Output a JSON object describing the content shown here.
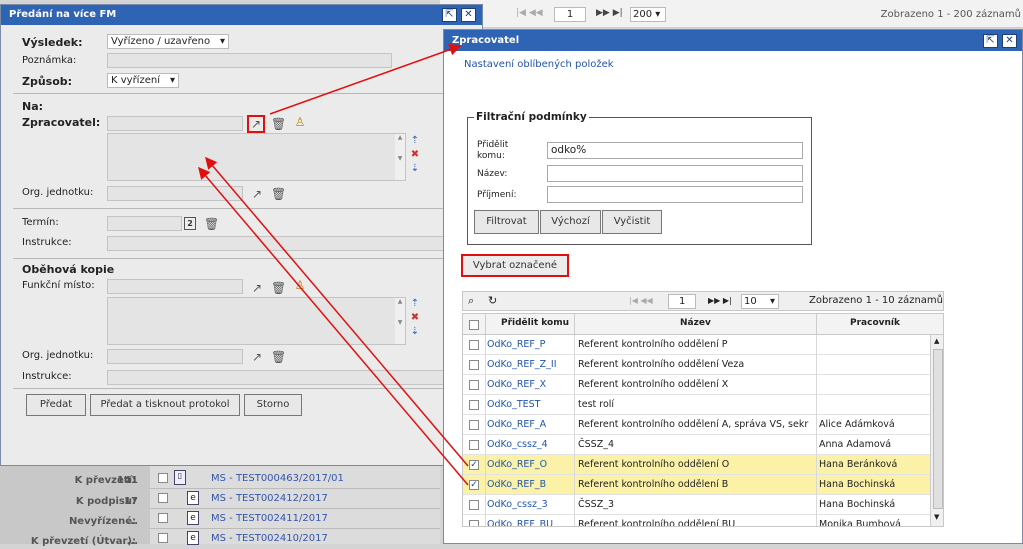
{
  "bg": {
    "pager_page": "1",
    "pager_size": "200",
    "status": "Zobrazeno 1 - 200 záznamů",
    "counters": [
      {
        "label": "K převzetí:",
        "value": "141"
      },
      {
        "label": "K podpisu:",
        "value": "17"
      },
      {
        "label": "Nevyřízené:",
        "value": "..."
      },
      {
        "label": "K převzetí (Útvar):",
        "value": "..."
      }
    ],
    "rows": [
      "MS - TEST000463/2017/01",
      "MS - TEST002412/2017",
      "MS - TEST002411/2017",
      "MS - TEST002410/2017"
    ]
  },
  "left": {
    "title": "Předání na více FM",
    "vysledek_label": "Výsledek:",
    "vysledek_value": "Vyřízeno / uzavřeno",
    "poznamka_label": "Poznámka:",
    "zpusob_label": "Způsob:",
    "zpusob_value": "K vyřízení",
    "na_label": "Na:",
    "zpracovatel_label": "Zpracovatel:",
    "org_label": "Org. jednotku:",
    "termin_label": "Termín:",
    "instrukce_label": "Instrukce:",
    "obehova_label": "Oběhová kopie",
    "funkcni_label": "Funkční místo:",
    "org2_label": "Org. jednotku:",
    "instrukce2_label": "Instrukce:",
    "btn_predat": "Předat",
    "btn_predat_tisk": "Předat a tisknout protokol",
    "btn_storno": "Storno"
  },
  "right": {
    "title": "Zpracovatel",
    "fav_link": "Nastavení oblíbených položek",
    "filter_legend": "Filtrační podmínky",
    "f_pridelit_label": "Přidělit komu:",
    "f_pridelit_value": "odko%",
    "f_nazev_label": "Název:",
    "f_prijmeni_label": "Příjmení:",
    "btn_filtrovat": "Filtrovat",
    "btn_vychozi": "Výchozí",
    "btn_vycistit": "Vyčistit",
    "btn_vybrat": "Vybrat označené",
    "pager_page": "1",
    "pager_size": "10",
    "status": "Zobrazeno 1 - 10 záznamů",
    "col_pridelit": "Přidělit komu",
    "col_nazev": "Název",
    "col_pracovnik": "Pracovník",
    "rows": [
      {
        "komu": "OdKo_REF_P",
        "nazev": "Referent kontrolního oddělení P",
        "pracovnik": "",
        "checked": false
      },
      {
        "komu": "OdKo_REF_Z_II",
        "nazev": "Referent kontrolního oddělení Veza",
        "pracovnik": "",
        "checked": false
      },
      {
        "komu": "OdKo_REF_X",
        "nazev": "Referent kontrolního oddělení X",
        "pracovnik": "",
        "checked": false
      },
      {
        "komu": "OdKo_TEST",
        "nazev": "test rolí",
        "pracovnik": "",
        "checked": false
      },
      {
        "komu": "OdKo_REF_A",
        "nazev": "Referent kontrolního oddělení A, správa VS, sekr",
        "pracovnik": "Alice Adámková",
        "checked": false
      },
      {
        "komu": "OdKo_cssz_4",
        "nazev": "ČSSZ_4",
        "pracovnik": "Anna Adamová",
        "checked": false
      },
      {
        "komu": "OdKo_REF_O",
        "nazev": "Referent kontrolního oddělení O",
        "pracovnik": "Hana Beránková",
        "checked": true
      },
      {
        "komu": "OdKo_REF_B",
        "nazev": "Referent kontrolního oddělení B",
        "pracovnik": "Hana Bochinská",
        "checked": true
      },
      {
        "komu": "OdKo_cssz_3",
        "nazev": "ČSSZ_3",
        "pracovnik": "Hana Bochinská",
        "checked": false
      },
      {
        "komu": "OdKo_REF_BU",
        "nazev": "Referent kontrolního oddělení BU",
        "pracovnik": "Monika Bumbová",
        "checked": false
      }
    ]
  },
  "colors": {
    "title_bar": "#2f63b3",
    "highlight": "#fbf2a8",
    "annotation": "#e01010"
  }
}
